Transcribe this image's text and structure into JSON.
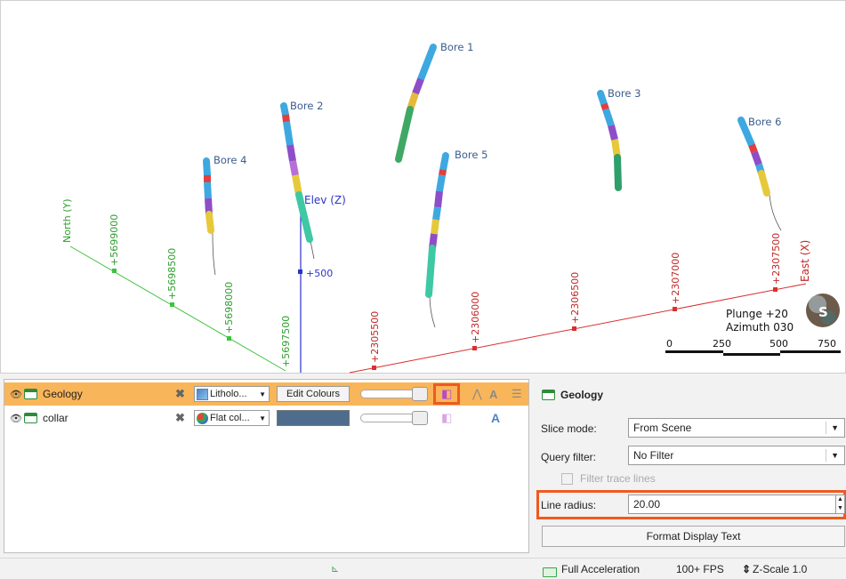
{
  "scene": {
    "bores": [
      {
        "label": "Bore 1"
      },
      {
        "label": "Bore 2"
      },
      {
        "label": "Bore 3"
      },
      {
        "label": "Bore 4"
      },
      {
        "label": "Bore 5"
      },
      {
        "label": "Bore 6"
      }
    ],
    "axes": {
      "north_label": "North (Y)",
      "elev_label": "Elev (Z)",
      "east_label": "East (X)",
      "north_ticks": [
        "+5699000",
        "+5698500",
        "+5698000",
        "+5697500"
      ],
      "east_ticks": [
        "+2305500",
        "+2306000",
        "+2306500",
        "+2307000",
        "+2307500"
      ],
      "elev_tick": "+500",
      "north_color": "#3ec23e",
      "east_color": "#d93030",
      "elev_color": "#2b33c9"
    },
    "orientation": {
      "plunge": "Plunge +20",
      "azimuth": "Azimuth 030"
    },
    "scale_bar": {
      "labels": [
        "0",
        "250",
        "500",
        "750"
      ]
    },
    "compass_letter": "S"
  },
  "objects": [
    {
      "name": "Geology",
      "colour_mode": "Litholo...",
      "button": "Edit Colours",
      "selected": true
    },
    {
      "name": "collar",
      "colour_mode": "Flat col...",
      "swatch_color": "#4e6d8d",
      "selected": false
    }
  ],
  "props": {
    "title": "Geology",
    "slice_mode_label": "Slice mode:",
    "slice_mode_value": "From Scene",
    "query_filter_label": "Query filter:",
    "query_filter_value": "No Filter",
    "filter_trace_label": "Filter trace lines",
    "line_radius_label": "Line radius:",
    "line_radius_value": "20.00",
    "format_button": "Format Display Text"
  },
  "status": {
    "acceleration": "Full Acceleration",
    "fps": "100+ FPS",
    "zscale": "Z-Scale 1.0"
  },
  "colors": {
    "highlight": "#ef5a20",
    "selected_row": "#f9b55a"
  }
}
